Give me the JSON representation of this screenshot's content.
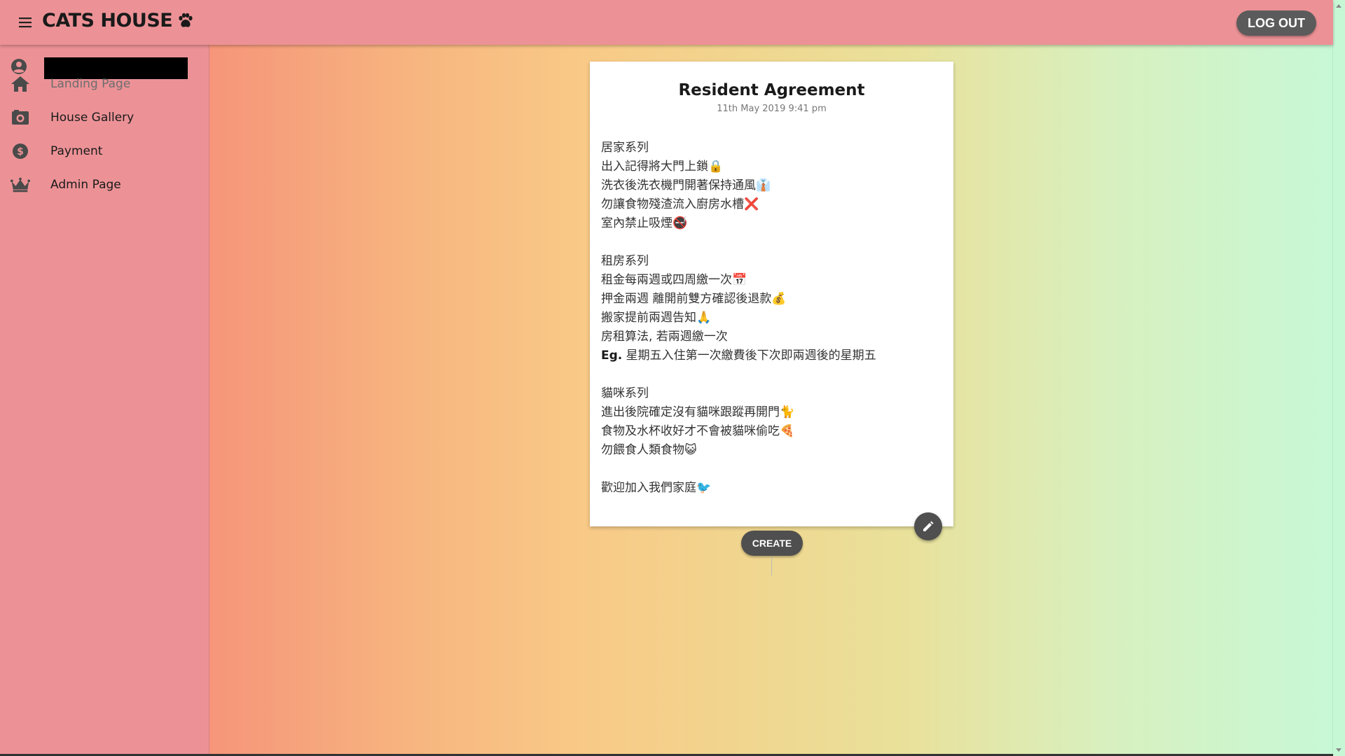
{
  "header": {
    "brand": "CATS HOUSE",
    "logout_label": "LOG OUT"
  },
  "sidebar": {
    "items": [
      {
        "label": "Landing Page",
        "icon": "home-icon"
      },
      {
        "label": "House Gallery",
        "icon": "camera-icon"
      },
      {
        "label": "Payment",
        "icon": "dollar-icon"
      },
      {
        "label": "Admin Page",
        "icon": "crown-icon"
      }
    ]
  },
  "card": {
    "title": "Resident Agreement",
    "date": "11th May 2019 9:41 pm",
    "lines": [
      "居家系列",
      "出入記得將大門上鎖🔒",
      "洗衣後洗衣機門開著保持通風👔",
      "勿讓食物殘渣流入廚房水槽❌",
      "室內禁止吸煙🚭",
      "",
      "租房系列",
      "租金每兩週或四周繳一次📅",
      "押金兩週 離開前雙方確認後退款💰",
      "搬家提前兩週告知🙏",
      "房租算法, 若兩週繳一次",
      "",
      "",
      "貓咪系列",
      "進出後院確定沒有貓咪跟蹤再開門🐈",
      "食物及水杯收好才不會被貓咪偷吃🍕",
      "勿餵食人類食物😺",
      "",
      "歡迎加入我們家庭🐦"
    ],
    "eg_label": "Eg.",
    "eg_text": " 星期五入住第一次繳費後下次即兩週後的星期五"
  },
  "create_label": "CREATE",
  "colors": {
    "header_bg": "#ec9296",
    "sidebar_bg": "#ec9296",
    "button_bg": "#4f4f4f",
    "gradient_start": "#f6957a",
    "gradient_end": "#c7f8d6"
  }
}
